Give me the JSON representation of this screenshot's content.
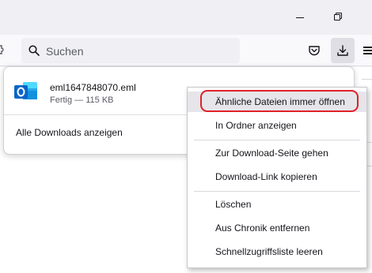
{
  "window": {
    "minimize_icon": "minimize-icon",
    "restore_icon": "restore-icon"
  },
  "toolbar": {
    "search_placeholder": "Suchen",
    "search_icon": "search-icon",
    "pocket_icon": "pocket-icon",
    "downloads_icon": "downloads-icon",
    "menu_icon": "hamburger-menu-icon"
  },
  "downloads_panel": {
    "items": [
      {
        "file_name": "eml1647848070.eml",
        "status": "Fertig — 115 KB",
        "icon": "outlook-icon"
      }
    ],
    "show_all_label": "Alle Downloads anzeigen"
  },
  "context_menu": {
    "items": [
      "Ähnliche Dateien immer öffnen",
      "In Ordner anzeigen",
      "Zur Download-Seite gehen",
      "Download-Link kopieren",
      "Löschen",
      "Aus Chronik entfernen",
      "Schnellzugriffsliste leeren"
    ],
    "highlighted_item": "Ähnliche Dateien immer öffnen"
  },
  "colors": {
    "highlight_outline": "#e0202a",
    "outlook_blue": "#0a64c8"
  }
}
